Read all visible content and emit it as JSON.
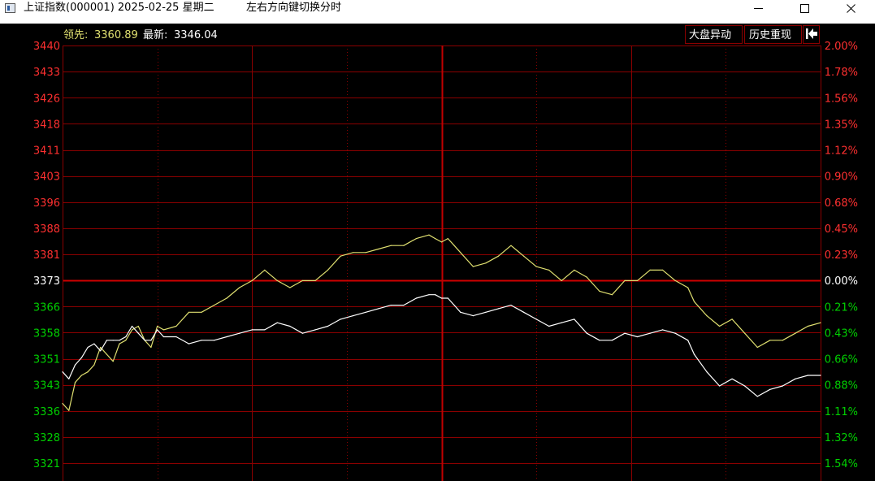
{
  "window": {
    "title": "上证指数(000001) 2025-02-25 星期二",
    "hint": "左右方向键切换分时"
  },
  "header": {
    "lead_label": "领先:",
    "lead_value": "3360.89",
    "latest_label": "最新:",
    "latest_value": "3346.04"
  },
  "buttons": {
    "market_anomaly": "大盘异动",
    "history_replay": "历史重现"
  },
  "colors": {
    "background": "#000000",
    "grid": "#8b0000",
    "up": "#ff3030",
    "down": "#00d000",
    "base": "#ffffff",
    "lead_line": "#e0e070",
    "latest_line": "#ffffff"
  },
  "chart_data": {
    "type": "line",
    "base_price": 3373,
    "ylim": [
      3321,
      3440
    ],
    "left_ticks": [
      "3440",
      "3433",
      "3426",
      "3418",
      "3411",
      "3403",
      "3396",
      "3388",
      "3381",
      "3373",
      "3366",
      "3358",
      "3351",
      "3343",
      "3336",
      "3328",
      "3321"
    ],
    "right_ticks": [
      "2.00%",
      "1.78%",
      "1.56%",
      "1.35%",
      "1.12%",
      "0.90%",
      "0.68%",
      "0.45%",
      "0.23%",
      "0.00%",
      "0.21%",
      "0.43%",
      "0.66%",
      "0.88%",
      "1.11%",
      "1.32%",
      "1.54%"
    ],
    "x_minutes": [
      0,
      60,
      120,
      180,
      240
    ],
    "series": [
      {
        "name": "领先",
        "color": "#e0e070",
        "x": [
          0,
          2,
          4,
          6,
          8,
          10,
          12,
          14,
          16,
          18,
          20,
          22,
          24,
          26,
          28,
          30,
          32,
          36,
          40,
          44,
          48,
          52,
          56,
          60,
          64,
          68,
          72,
          76,
          80,
          84,
          88,
          92,
          96,
          100,
          104,
          108,
          112,
          116,
          118,
          120,
          122,
          124,
          126,
          130,
          134,
          138,
          142,
          146,
          150,
          154,
          158,
          162,
          166,
          170,
          174,
          178,
          182,
          186,
          190,
          194,
          198,
          200,
          204,
          208,
          212,
          216,
          220,
          224,
          228,
          232,
          236,
          240
        ],
        "y": [
          3338,
          3336,
          3344,
          3346,
          3347,
          3349,
          3354,
          3352,
          3350,
          3355,
          3356,
          3359,
          3360,
          3356,
          3354,
          3360,
          3359,
          3360,
          3364,
          3364,
          3366,
          3368,
          3371,
          3373,
          3376,
          3373,
          3371,
          3373,
          3373,
          3376,
          3380,
          3381,
          3381,
          3382,
          3383,
          3383,
          3385,
          3386,
          3385,
          3384,
          3385,
          3383,
          3381,
          3377,
          3378,
          3380,
          3383,
          3380,
          3377,
          3376,
          3373,
          3376,
          3374,
          3370,
          3369,
          3373,
          3373,
          3376,
          3376,
          3373,
          3371,
          3367,
          3363,
          3360,
          3362,
          3358,
          3354,
          3356,
          3356,
          3358,
          3360,
          3361
        ],
        "last": "3360.89"
      },
      {
        "name": "最新",
        "color": "#ffffff",
        "x": [
          0,
          2,
          4,
          6,
          8,
          10,
          12,
          14,
          16,
          18,
          20,
          22,
          24,
          26,
          28,
          30,
          32,
          36,
          40,
          44,
          48,
          52,
          56,
          60,
          64,
          68,
          72,
          76,
          80,
          84,
          88,
          92,
          96,
          100,
          104,
          108,
          112,
          116,
          118,
          120,
          122,
          124,
          126,
          130,
          134,
          138,
          142,
          146,
          150,
          154,
          158,
          162,
          166,
          170,
          174,
          178,
          182,
          186,
          190,
          194,
          198,
          200,
          204,
          208,
          212,
          216,
          220,
          224,
          228,
          232,
          236,
          240
        ],
        "y": [
          3347,
          3345,
          3349,
          3351,
          3354,
          3355,
          3353,
          3356,
          3356,
          3356,
          3357,
          3360,
          3358,
          3356,
          3356,
          3359,
          3357,
          3357,
          3355,
          3356,
          3356,
          3357,
          3358,
          3359,
          3359,
          3361,
          3360,
          3358,
          3359,
          3360,
          3362,
          3363,
          3364,
          3365,
          3366,
          3366,
          3368,
          3369,
          3369,
          3368,
          3368,
          3366,
          3364,
          3363,
          3364,
          3365,
          3366,
          3364,
          3362,
          3360,
          3361,
          3362,
          3358,
          3356,
          3356,
          3358,
          3357,
          3358,
          3359,
          3358,
          3356,
          3352,
          3347,
          3343,
          3345,
          3343,
          3340,
          3342,
          3343,
          3345,
          3346,
          3346
        ],
        "last": "3346.04"
      }
    ]
  }
}
